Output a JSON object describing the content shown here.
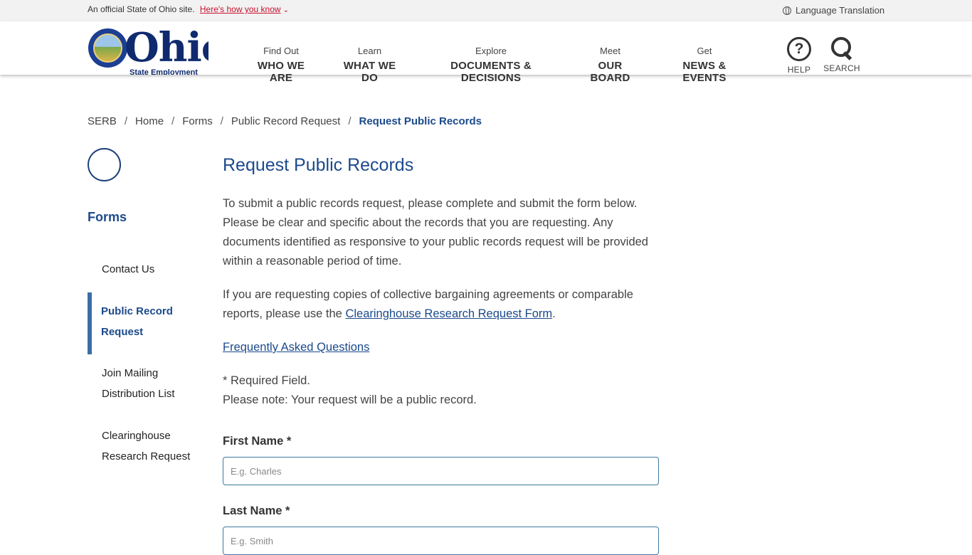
{
  "topbar": {
    "official_text": "An official State of Ohio site.",
    "how_link": "Here's how you know",
    "language": "Language Translation"
  },
  "logo": {
    "text": "Ohio",
    "subtext": "State Employment"
  },
  "nav": [
    {
      "small": "Find Out",
      "big": "WHO WE ARE"
    },
    {
      "small": "Learn",
      "big": "WHAT WE DO"
    },
    {
      "small": "Explore",
      "big": "DOCUMENTS & DECISIONS"
    },
    {
      "small": "Meet",
      "big": "OUR BOARD"
    },
    {
      "small": "Get",
      "big": "NEWS & EVENTS"
    }
  ],
  "utility": {
    "help_glyph": "?",
    "help_label": "HELP",
    "search_label": "SEARCH"
  },
  "breadcrumb": {
    "items": [
      "SERB",
      "Home",
      "Forms",
      "Public Record Request"
    ],
    "current": "Request Public Records",
    "separator": "/"
  },
  "sidebar": {
    "title": "Forms",
    "items": [
      {
        "line1": "Contact Us",
        "line2": ""
      },
      {
        "line1": "Public Record",
        "line2": "Request",
        "active": true
      },
      {
        "line1": "Join Mailing",
        "line2": "Distribution List"
      },
      {
        "line1": "Clearinghouse",
        "line2": "Research Request"
      }
    ]
  },
  "main": {
    "title": "Request Public Records",
    "intro": "To submit a public records request, please complete and submit the form below. Please be clear and specific about the records that you are requesting. Any documents identified as responsive to your public records request will be provided within a reasonable period of time.",
    "cba_before": "If you are requesting copies of collective bargaining agreements or comparable reports, please use the ",
    "cba_link": "Clearinghouse Research Request Form",
    "cba_after": ".",
    "faq_link": "Frequently Asked Questions",
    "required_note": "* Required Field.",
    "public_note": "Please note: Your request will be a public record.",
    "fields": [
      {
        "label": "First Name *",
        "placeholder": "E.g. Charles"
      },
      {
        "label": "Last Name *",
        "placeholder": "E.g. Smith"
      }
    ]
  },
  "colors": {
    "primary_blue": "#1c4a8c",
    "accent_red": "#c8102e",
    "topbar_bg": "#f2f2f2",
    "active_bar": "#3b6ea5"
  }
}
